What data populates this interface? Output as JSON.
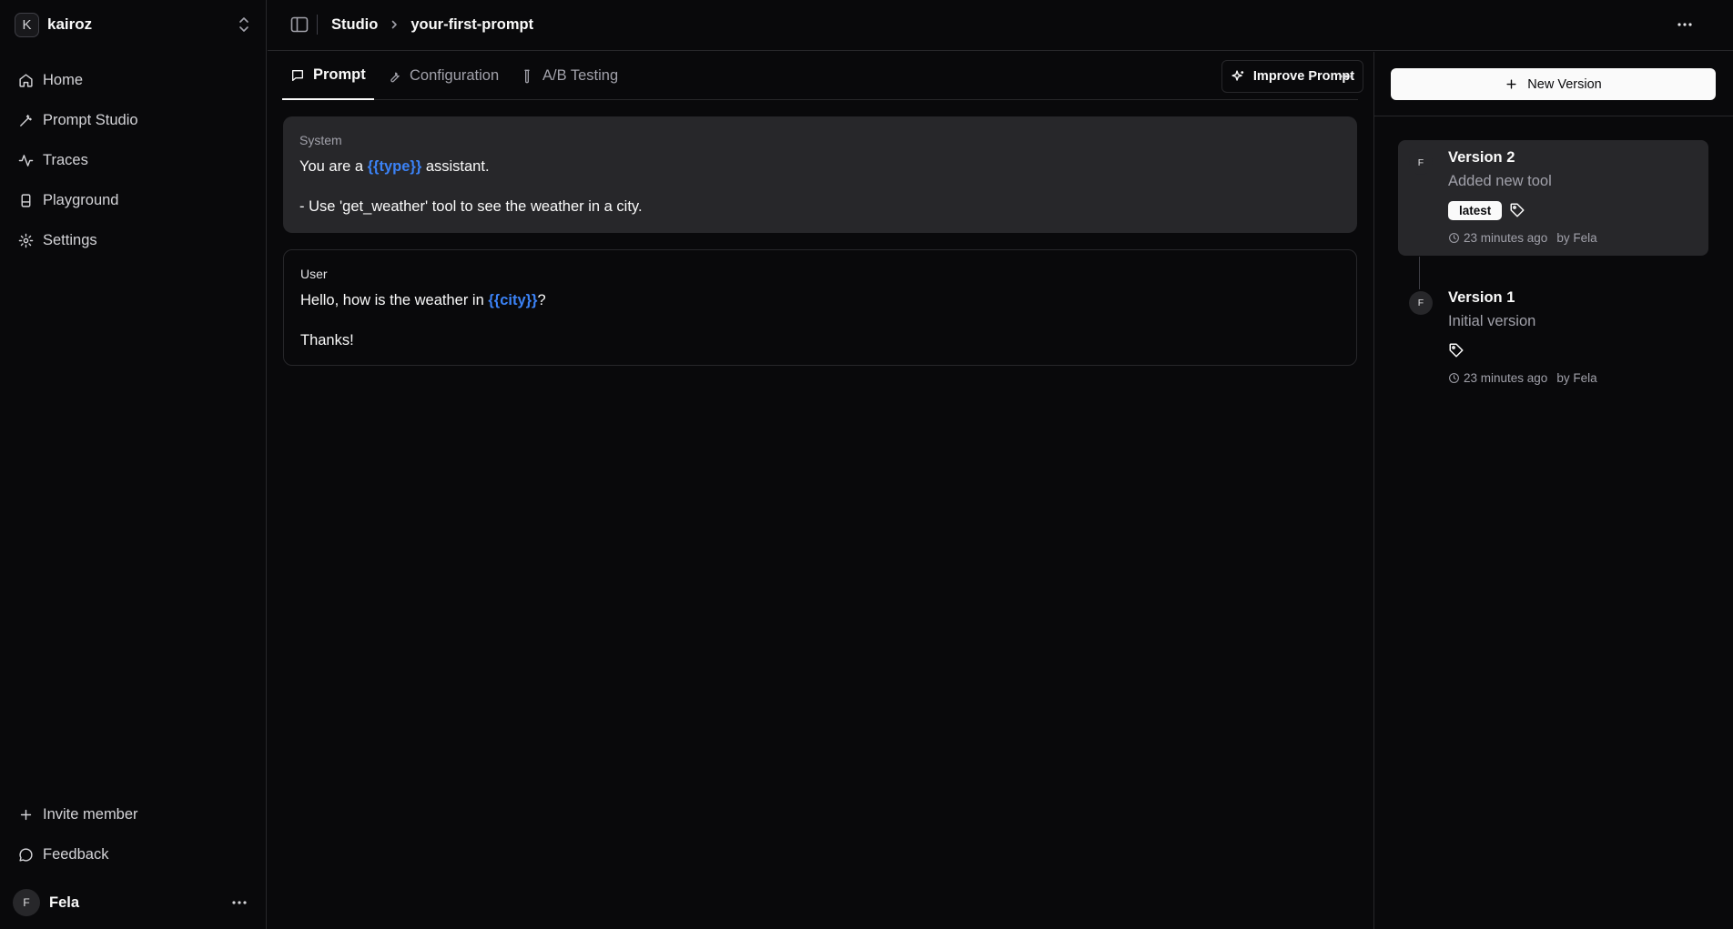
{
  "workspace": {
    "initial": "K",
    "name": "kairoz"
  },
  "nav": {
    "items": [
      {
        "label": "Home",
        "icon": "home-icon"
      },
      {
        "label": "Prompt Studio",
        "icon": "wand-icon"
      },
      {
        "label": "Traces",
        "icon": "activity-icon"
      },
      {
        "label": "Playground",
        "icon": "flask-icon"
      },
      {
        "label": "Settings",
        "icon": "gear-icon"
      }
    ],
    "invite_label": "Invite member",
    "feedback_label": "Feedback"
  },
  "user": {
    "initial": "F",
    "name": "Fela"
  },
  "header": {
    "breadcrumb_root": "Studio",
    "breadcrumb_current": "your-first-prompt"
  },
  "tabs": [
    {
      "label": "Prompt",
      "active": true
    },
    {
      "label": "Configuration",
      "active": false
    },
    {
      "label": "A/B Testing",
      "active": false
    }
  ],
  "toolbar": {
    "improve_label": "Improve Prompt"
  },
  "messages": {
    "system": {
      "role": "System",
      "line1_pre": "You are a ",
      "line1_var": "{{type}}",
      "line1_post": " assistant.",
      "line2": "- Use 'get_weather' tool to see the weather in a city."
    },
    "user": {
      "role": "User",
      "line1_pre": "Hello, how is the weather in ",
      "line1_var": "{{city}}",
      "line1_post": "?",
      "line2": "Thanks!"
    }
  },
  "versions_panel": {
    "new_version_label": "New Version",
    "versions": [
      {
        "author_initial": "F",
        "title": "Version 2",
        "description": "Added new tool",
        "badge": "latest",
        "time": "23 minutes ago",
        "author": "by Fela"
      },
      {
        "author_initial": "F",
        "title": "Version 1",
        "description": "Initial version",
        "badge": "",
        "time": "23 minutes ago",
        "author": "by Fela"
      }
    ]
  },
  "colors": {
    "background": "#09090b",
    "surface": "#27272a",
    "variable": "#3b82f6",
    "text": "#fafafa",
    "muted": "#a1a1aa"
  }
}
